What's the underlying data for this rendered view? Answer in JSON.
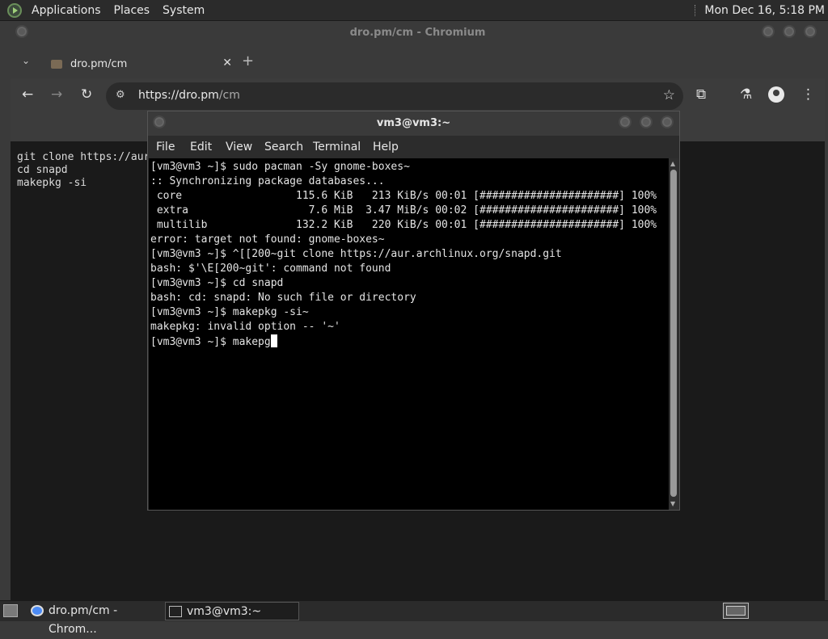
{
  "top_panel": {
    "menus": [
      "Applications",
      "Places",
      "System"
    ],
    "clock": "Mon Dec 16,  5:18 PM"
  },
  "browser": {
    "window_title": "dro.pm/cm - Chromium",
    "tab": {
      "title": "dro.pm/cm",
      "close": "✕"
    },
    "new_tab": "+",
    "url_host": "https://dro.pm",
    "url_path": "/cm",
    "page_lines": [
      "git clone https://aur",
      "cd snapd",
      "makepkg -si"
    ],
    "icons": [
      "tab-search-icon",
      "back-icon",
      "forward-icon",
      "reload-icon",
      "site-settings-icon",
      "bookmark-star-icon",
      "extensions-icon",
      "labs-icon",
      "profile-icon",
      "menu-icon"
    ]
  },
  "terminal": {
    "window_title": "vm3@vm3:~",
    "menu": [
      "File",
      "Edit",
      "View",
      "Search",
      "Terminal",
      "Help"
    ],
    "lines": [
      "[vm3@vm3 ~]$ sudo pacman -Sy gnome-boxes~",
      ":: Synchronizing package databases...",
      " core                  115.6 KiB   213 KiB/s 00:01 [######################] 100%",
      " extra                   7.6 MiB  3.47 MiB/s 00:02 [######################] 100%",
      " multilib              132.2 KiB   220 KiB/s 00:01 [######################] 100%",
      "error: target not found: gnome-boxes~",
      "[vm3@vm3 ~]$ ^[[200~git clone https://aur.archlinux.org/snapd.git",
      "bash: $'\\E[200~git': command not found",
      "[vm3@vm3 ~]$ cd snapd",
      "bash: cd: snapd: No such file or directory",
      "[vm3@vm3 ~]$ makepkg -si~",
      "makepkg: invalid option -- '~'",
      "[vm3@vm3 ~]$ makepg"
    ]
  },
  "taskbar": {
    "tasks": [
      {
        "label": "dro.pm/cm - Chrom...",
        "icon": "chromium-icon",
        "active": false
      },
      {
        "label": "vm3@vm3:~",
        "icon": "terminal-icon",
        "active": true
      }
    ]
  }
}
